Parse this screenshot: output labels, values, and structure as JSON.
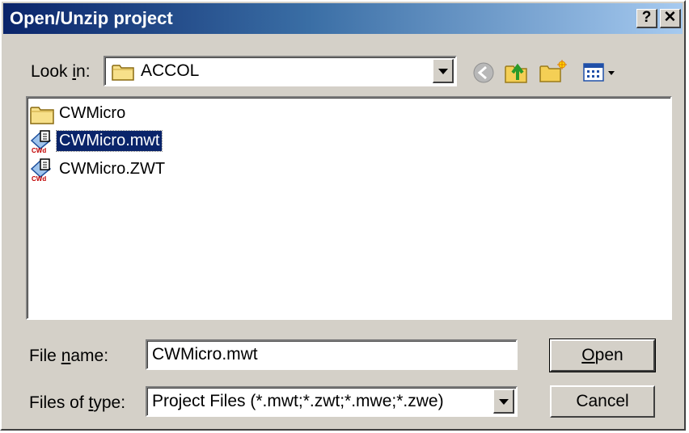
{
  "window": {
    "title": "Open/Unzip project",
    "help_label": "?",
    "close_label": "✕"
  },
  "look_in": {
    "label_pre": "Look ",
    "label_key": "i",
    "label_post": "n:",
    "value": "ACCOL",
    "icon": "folder-icon"
  },
  "toolbar": {
    "icons": [
      "back-icon",
      "up-folder-icon",
      "new-folder-icon",
      "view-menu-icon"
    ]
  },
  "files": [
    {
      "name": "CWMicro",
      "icon": "folder-icon",
      "selected": false
    },
    {
      "name": "CWMicro.mwt",
      "icon": "project-file-icon",
      "selected": true
    },
    {
      "name": "CWMicro.ZWT",
      "icon": "project-file-icon",
      "selected": false
    }
  ],
  "file_name": {
    "label_pre": "File ",
    "label_key": "n",
    "label_post": "ame:",
    "value": "CWMicro.mwt"
  },
  "file_type": {
    "label_pre": "Files of ",
    "label_key": "t",
    "label_post": "ype:",
    "value": "Project Files (*.mwt;*.zwt;*.mwe;*.zwe)"
  },
  "buttons": {
    "open_key": "O",
    "open_rest": "pen",
    "cancel": "Cancel"
  },
  "colors": {
    "title_start": "#0a246a",
    "title_end": "#a6caf0",
    "face": "#d4d0c8",
    "selection": "#0a246a"
  }
}
